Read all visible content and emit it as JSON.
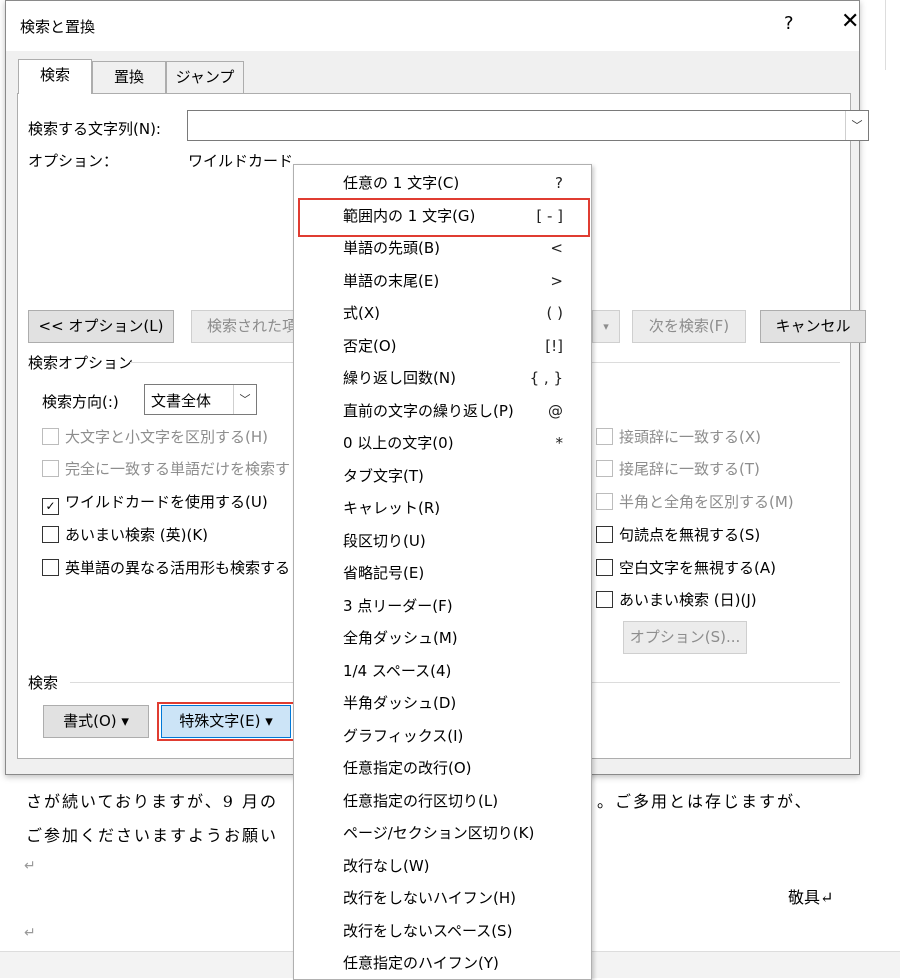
{
  "document": {
    "line1_left": "さが続いておりますが、9 月の",
    "line1_right": "。ご多用とは存じますが、",
    "line2_left": "ご参加くださいますようお願い",
    "closing": "敬具↵",
    "return_mark": "↵",
    "edge_chars": "0\n2"
  },
  "dialog": {
    "title": "検索と置換",
    "help": "?",
    "close": "✕",
    "tabs": [
      "検索",
      "置換",
      "ジャンプ"
    ],
    "find_label": "検索する文字列(N):",
    "find_value": "",
    "options_label": "オプション：",
    "options_value": "ワイルドカード",
    "buttons": {
      "options": "<< オプション(L)",
      "highlight": "検索された項",
      "find_next": "次を検索(F)",
      "cancel": "キャンセル",
      "format": "書式(O) ▾",
      "special": "特殊文字(E) ▾",
      "sounds_like_options": "オプション(S)..."
    },
    "search_options_header": "検索オプション",
    "direction_label": "検索方向(:)",
    "direction_value": "文書全体",
    "checkboxes_left": [
      {
        "label": "大文字と小文字を区別する(H)",
        "checked": false,
        "disabled": true
      },
      {
        "label": "完全に一致する単語だけを検索す",
        "checked": false,
        "disabled": true
      },
      {
        "label": "ワイルドカードを使用する(U)",
        "checked": true,
        "disabled": false
      },
      {
        "label": "あいまい検索 (英)(K)",
        "checked": false,
        "disabled": false
      },
      {
        "label": "英単語の異なる活用形も検索する",
        "checked": false,
        "disabled": false
      }
    ],
    "checkboxes_right": [
      {
        "label": "接頭辞に一致する(X)",
        "checked": false,
        "disabled": true
      },
      {
        "label": "接尾辞に一致する(T)",
        "checked": false,
        "disabled": true
      },
      {
        "label": "半角と全角を区別する(M)",
        "checked": false,
        "disabled": true
      },
      {
        "label": "句読点を無視する(S)",
        "checked": false,
        "disabled": false
      },
      {
        "label": "空白文字を無視する(A)",
        "checked": false,
        "disabled": false
      },
      {
        "label": "あいまい検索 (日)(J)",
        "checked": false,
        "disabled": false
      }
    ],
    "search_section_header": "検索"
  },
  "menu": {
    "items": [
      {
        "label": "任意の 1 文字(C)",
        "symbol": "?"
      },
      {
        "label": "範囲内の 1 文字(G)",
        "symbol": "[ - ]",
        "highlighted": true
      },
      {
        "label": "単語の先頭(B)",
        "symbol": "<"
      },
      {
        "label": "単語の末尾(E)",
        "symbol": ">"
      },
      {
        "label": "式(X)",
        "symbol": "( )"
      },
      {
        "label": "否定(O)",
        "symbol": "[!]"
      },
      {
        "label": "繰り返し回数(N)",
        "symbol": "{ , }"
      },
      {
        "label": "直前の文字の繰り返し(P)",
        "symbol": "@"
      },
      {
        "label": "0 以上の文字(0)",
        "symbol": "*"
      },
      {
        "label": "タブ文字(T)",
        "symbol": ""
      },
      {
        "label": "キャレット(R)",
        "symbol": ""
      },
      {
        "label": "段区切り(U)",
        "symbol": ""
      },
      {
        "label": "省略記号(E)",
        "symbol": ""
      },
      {
        "label": "3 点リーダー(F)",
        "symbol": ""
      },
      {
        "label": "全角ダッシュ(M)",
        "symbol": ""
      },
      {
        "label": "1/4 スペース(4)",
        "symbol": ""
      },
      {
        "label": "半角ダッシュ(D)",
        "symbol": ""
      },
      {
        "label": "グラフィックス(I)",
        "symbol": ""
      },
      {
        "label": "任意指定の改行(O)",
        "symbol": ""
      },
      {
        "label": "任意指定の行区切り(L)",
        "symbol": ""
      },
      {
        "label": "ページ/セクション区切り(K)",
        "symbol": ""
      },
      {
        "label": "改行なし(W)",
        "symbol": ""
      },
      {
        "label": "改行をしないハイフン(H)",
        "symbol": ""
      },
      {
        "label": "改行をしないスペース(S)",
        "symbol": ""
      },
      {
        "label": "任意指定のハイフン(Y)",
        "symbol": ""
      }
    ]
  },
  "colors": {
    "highlight_border": "#e03c31",
    "dialog_bg": "#f0f0f0",
    "button_bg": "#e1e1e1"
  }
}
